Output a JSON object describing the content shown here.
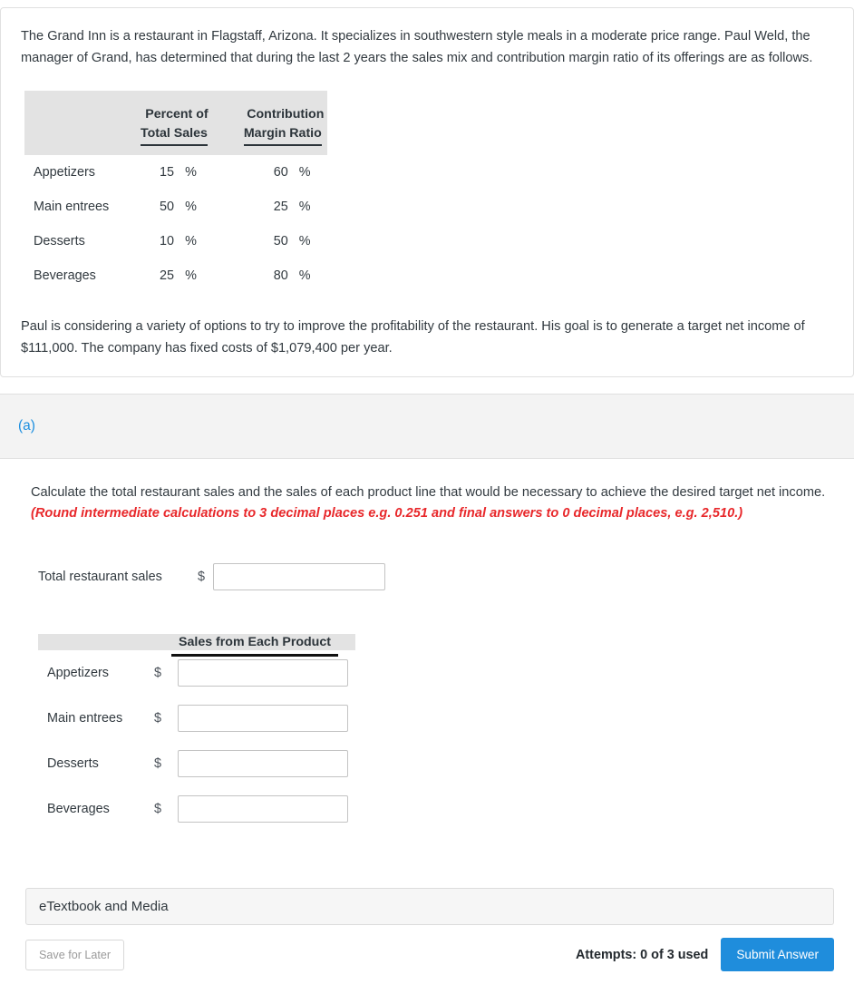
{
  "problem": {
    "intro": "The Grand Inn is a restaurant in Flagstaff, Arizona. It specializes in southwestern style meals in a moderate price range. Paul Weld, the manager of Grand, has determined that during the last 2 years the sales mix and contribution margin ratio of its offerings are as follows.",
    "goal": "Paul is considering a variety of options to try to improve the profitability of the restaurant. His goal is to generate a target net income of $111,000. The company has fixed costs of $1,079,400 per year."
  },
  "mix_table": {
    "headers": {
      "blank": "",
      "percent_line1": "Percent of",
      "percent_line2": "Total Sales",
      "margin_line1": "Contribution",
      "margin_line2": "Margin Ratio"
    },
    "percent_symbol": "%",
    "rows": [
      {
        "label": "Appetizers",
        "percent_total_sales": "15",
        "contribution_margin_ratio": "60"
      },
      {
        "label": "Main entrees",
        "percent_total_sales": "50",
        "contribution_margin_ratio": "25"
      },
      {
        "label": "Desserts",
        "percent_total_sales": "10",
        "contribution_margin_ratio": "50"
      },
      {
        "label": "Beverages",
        "percent_total_sales": "25",
        "contribution_margin_ratio": "80"
      }
    ]
  },
  "part": {
    "label": "(a)",
    "label_color": "#1d8fe0",
    "instruction_main": "Calculate the total restaurant sales and the sales of each product line that would be necessary to achieve the desired target net income. ",
    "instruction_note": "(Round intermediate calculations to 3 decimal places e.g. 0.251 and final answers to 0 decimal places, e.g. 2,510.)",
    "note_color": "#e8282b"
  },
  "total_sales": {
    "label": "Total restaurant sales",
    "currency": "$",
    "value": "",
    "placeholder": ""
  },
  "product_table": {
    "header_blank": "",
    "header": "Sales from Each Product",
    "currency": "$",
    "rows": [
      {
        "label": "Appetizers",
        "value": "",
        "placeholder": ""
      },
      {
        "label": "Main entrees",
        "value": "",
        "placeholder": ""
      },
      {
        "label": "Desserts",
        "value": "",
        "placeholder": ""
      },
      {
        "label": "Beverages",
        "value": "",
        "placeholder": ""
      }
    ]
  },
  "footer": {
    "etextbook_label": "eTextbook and Media",
    "save_label": "Save for Later",
    "attempts_label": "Attempts: 0 of 3 used",
    "submit_label": "Submit Answer",
    "submit_color": "#1f8ddc"
  }
}
